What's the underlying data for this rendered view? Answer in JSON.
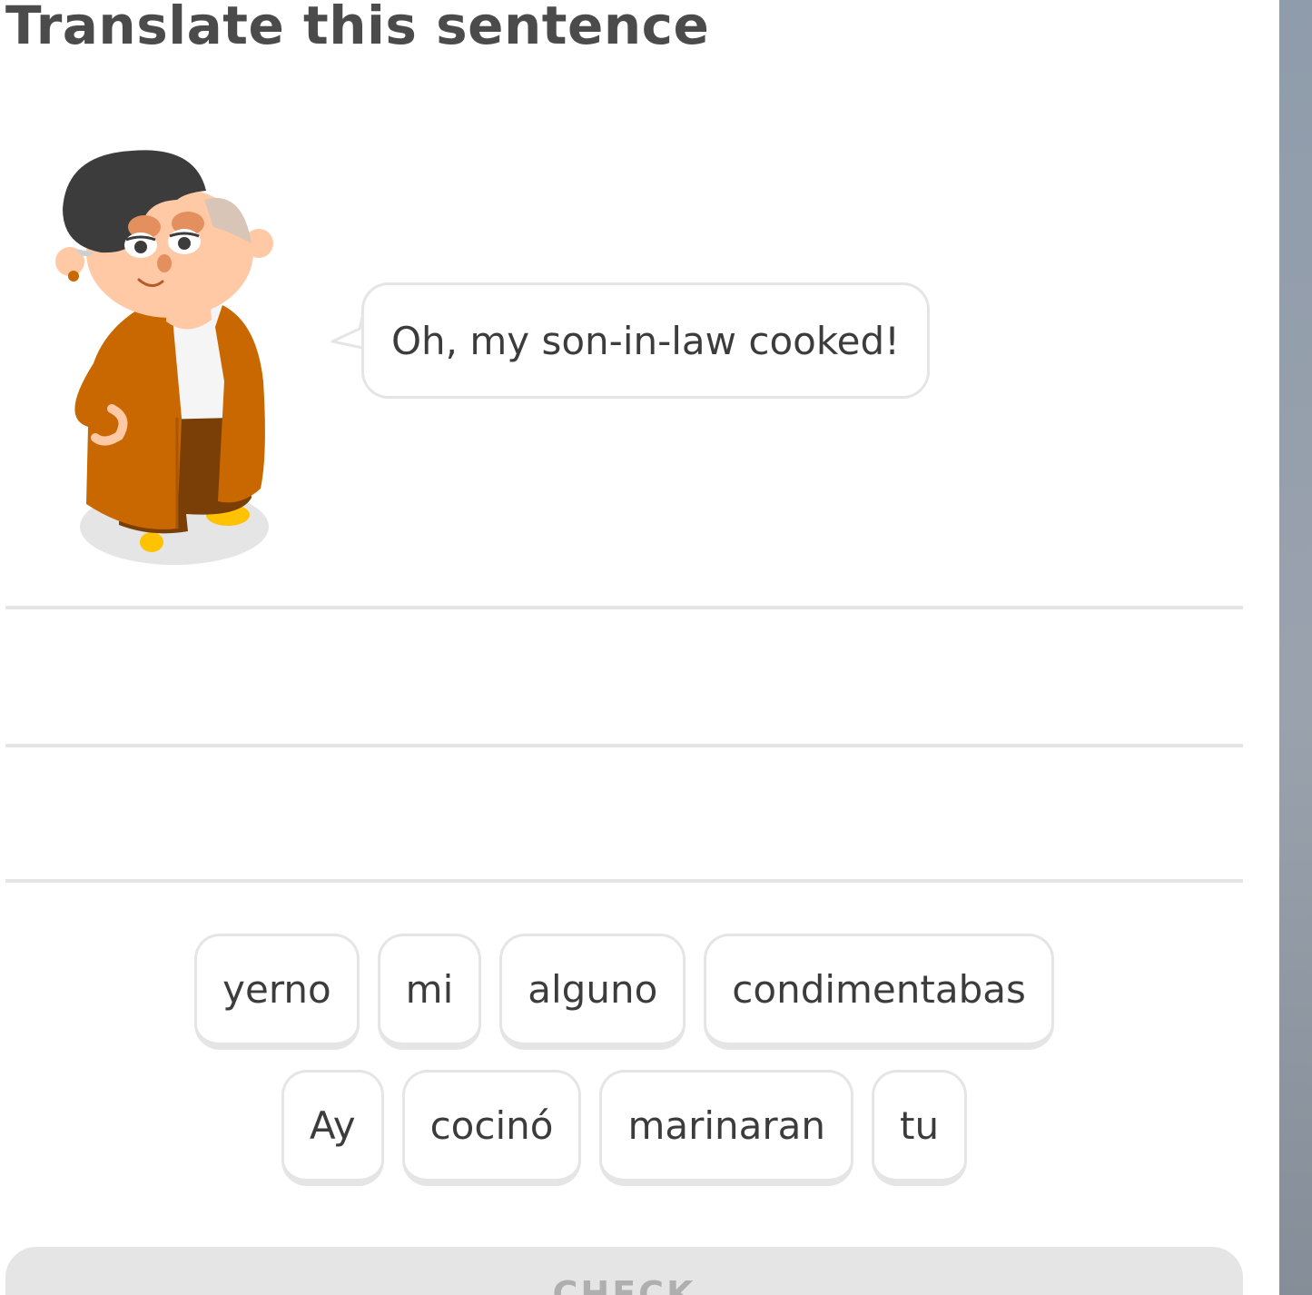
{
  "header": {
    "title": "Translate this sentence"
  },
  "prompt": {
    "character_icon": "old-man-character-illustration",
    "speech_text": "Oh, my son-in-law cooked!"
  },
  "answer_area": {
    "line_count": 3
  },
  "word_bank": {
    "row1": [
      "yerno",
      "mi",
      "alguno",
      "condimentabas"
    ],
    "row2": [
      "Ay",
      "cocinó",
      "marinaran",
      "tu"
    ]
  },
  "footer": {
    "check_label": "CHECK",
    "check_enabled": false
  },
  "colors": {
    "title": "#4b4b4b",
    "tile_border": "#e5e5e5",
    "text": "#3c3c3c",
    "disabled_button": "#e5e5e5",
    "disabled_text": "#afafaf",
    "coat": "#c96800",
    "hair": "#3c3c3c"
  }
}
